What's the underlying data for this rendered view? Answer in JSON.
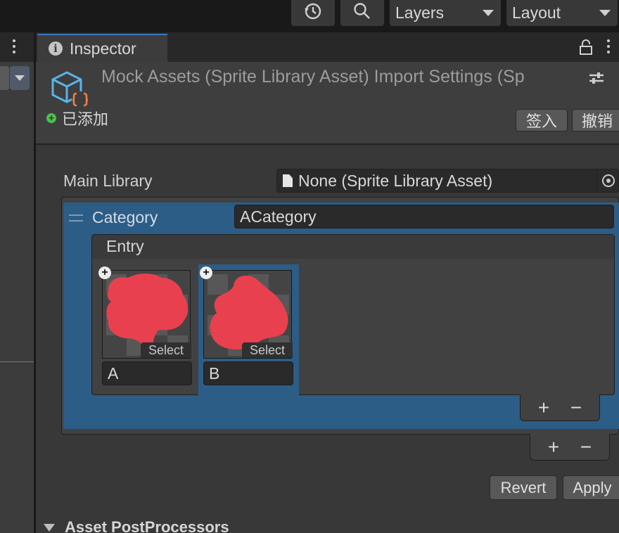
{
  "toolbar": {
    "history_icon": "history-icon",
    "search_icon": "search-icon",
    "layers_label": "Layers",
    "layout_label": "Layout"
  },
  "inspector": {
    "tab_label": "Inspector",
    "title": "Mock Assets (Sprite Library Asset) Import Settings (Sp",
    "status_label": "已添加",
    "checkin_label": "签入",
    "revert_vc_label": "撤销",
    "main_library_label": "Main Library",
    "main_library_value": "None (Sprite Library Asset)",
    "category_label": "Category",
    "category_value": "ACategory",
    "entry_header": "Entry",
    "entries": [
      {
        "select_label": "Select",
        "name": "A"
      },
      {
        "select_label": "Select",
        "name": "B"
      }
    ],
    "add_symbol": "+",
    "remove_symbol": "−",
    "revert_label": "Revert",
    "apply_label": "Apply",
    "postprocessors_label": "Asset PostProcessors"
  },
  "colors": {
    "selection": "#2c5d87",
    "tab_accent": "#3a79bb",
    "sprite_red": "#e8404f",
    "asset_icon_blue": "#5ab4e8",
    "asset_icon_orange": "#f08040"
  }
}
